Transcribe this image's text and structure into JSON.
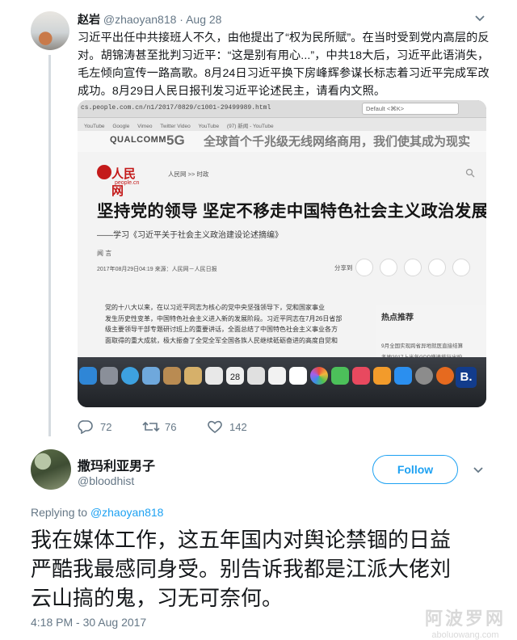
{
  "parent_tweet": {
    "display_name": "赵岩",
    "handle": "@zhaoyan818",
    "separator": "·",
    "date": "Aug 28",
    "text_lines": [
      "习近平出任中共接班人不久，由他提出了“权为民所赋”。在当时受到党内高层的反",
      "对。胡锦涛甚至批判习近平：“这是别有用心...”，中共18大后，习近平此语消失，",
      "毛左倾向宣传一路高歌。8月24日习近平换下房峰辉参谋长标志着习近平完成军改",
      "成功。8月29日人民日报刊发习近平论述民主，请看内文照。"
    ],
    "photo": {
      "url": "cs.people.com.cn/n1/2017/0829/c1001-29499989.html",
      "address_field": "Default <⌘K>",
      "bookmarks": [
        "YouTube",
        "Google",
        "Vimeo",
        "Twitter Video",
        "YouTube",
        "(97) 新闻 - YouTube"
      ],
      "banner_brand": "QUALCOMM",
      "banner_5g": "5G",
      "banner_slogan": "全球首个千兆级无线网络商用，我们使其成为现实",
      "logo_cn": "人民网",
      "logo_en": "people.cn",
      "breadcrumb": "人民网 >> 时政",
      "headline": "坚持党的领导 坚定不移走中国特色社会主义政治发展道路",
      "subtitle": "——学习《习近平关于社会主义政治建设论述摘编》",
      "author": "闻 言",
      "dateline": "2017年08月29日04:19  来源：人民网－人民日报",
      "share_label": "分享到",
      "body_lines": [
        "党的十八大以来，在以习近平同志为核心的党中央坚强领导下，党和国家事业",
        "发生历史性变革，中国特色社会主义进入新的发展阶段。习近平同志在7月26日省部",
        "级主要领导干部专题研讨班上的重要讲话，全面总结了中国特色社会主义事业各方",
        "面取得的重大成就，极大振奋了全党全军全国各族人民继续砥砺奋进的高度自觉和"
      ],
      "hot_title": "热点推荐",
      "hot_items": [
        "9月全国实现跨省异地就医直接结算",
        "各地2017上半年GDP增速排行出炉"
      ],
      "dock_date": "28",
      "dock_letter": "B."
    },
    "actions": {
      "reply_count": "72",
      "retweet_count": "76",
      "like_count": "142"
    }
  },
  "main_tweet": {
    "display_name": "撒玛利亚男子",
    "handle": "@bloodhist",
    "follow_label": "Follow",
    "replying_prefix": "Replying to",
    "replying_handle": "@zhaoyan818",
    "text_lines": [
      "我在媒体工作，这五年国内对舆论禁锢的日益",
      "严酷我最感同身受。别告诉我都是江派大佬刘",
      "云山搞的鬼，习无可奈何。"
    ],
    "timestamp": "4:18 PM - 30 Aug 2017"
  },
  "watermark": {
    "cn": "阿波罗网",
    "en": "aboluowang.com"
  },
  "colors": {
    "accent": "#1da1f2",
    "secondary_text": "#657786",
    "primary_text": "#14171a",
    "thread_line": "#d5dbe0",
    "people_red": "#c41a1a"
  },
  "icons": [
    "chevron-down-icon",
    "reply-icon",
    "retweet-icon",
    "heart-icon",
    "search-icon"
  ]
}
